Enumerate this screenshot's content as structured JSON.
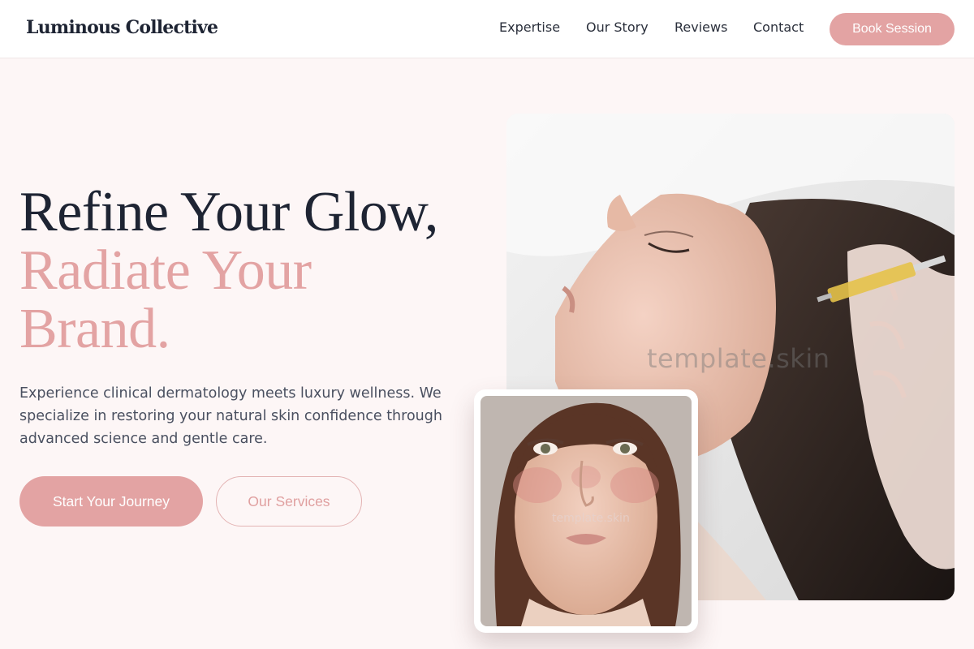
{
  "header": {
    "brand": "Luminous Collective",
    "nav": [
      "Expertise",
      "Our Story",
      "Reviews",
      "Contact"
    ],
    "cta": "Book Session"
  },
  "hero": {
    "headline_line1": "Refine Your Glow,",
    "headline_line2": "Radiate Your Brand.",
    "description": "Experience clinical dermatology meets luxury wellness. We specialize in restoring your natural skin confidence through advanced science and gentle care.",
    "primary_cta": "Start Your Journey",
    "secondary_cta": "Our Services"
  },
  "images": {
    "main_watermark": "template.skin",
    "inset_watermark": "template.skin"
  },
  "colors": {
    "accent": "#e3a3a3",
    "text_dark": "#1e2433",
    "background": "#fdf6f6"
  }
}
